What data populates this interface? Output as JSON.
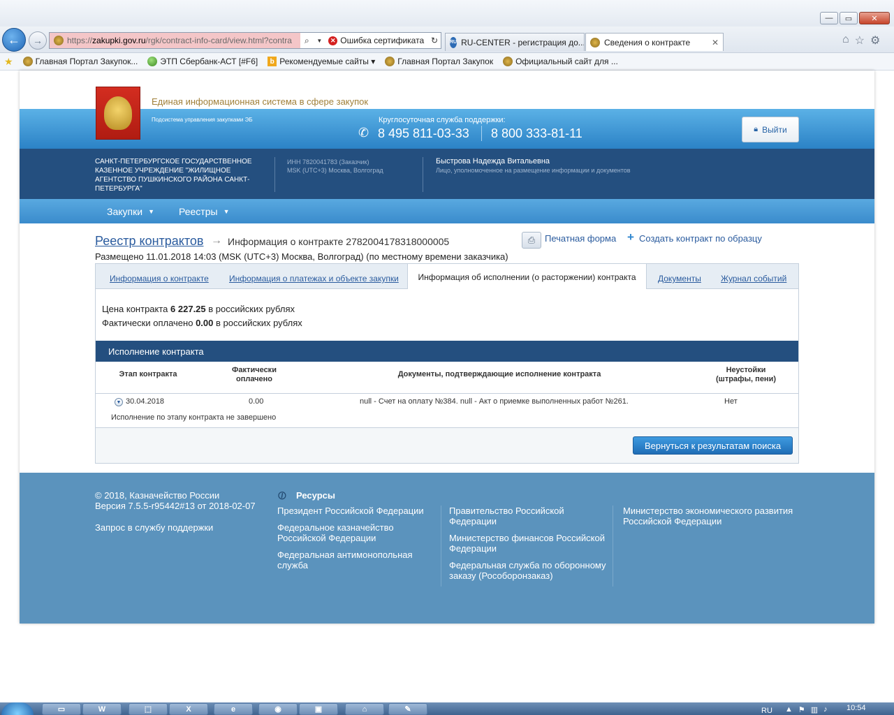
{
  "browser": {
    "url_host": "zakupki.gov.ru",
    "url_prefix": "https://",
    "url_path": "/rgk/contract-info-card/view.html?contra",
    "cert_error": "Ошибка сертификата",
    "tabs": [
      {
        "label": "RU-CENTER - регистрация до..."
      },
      {
        "label": "Сведения о контракте",
        "active": true
      }
    ],
    "favorites": [
      {
        "label": "Главная Портал Закупок..."
      },
      {
        "label": "ЭТП Сбербанк-АСТ [#F6]"
      },
      {
        "label": "Рекомендуемые сайты ▾"
      },
      {
        "label": "Главная Портал Закупок"
      },
      {
        "label": "Официальный сайт для ..."
      }
    ]
  },
  "header": {
    "system_title": "Единая информационная система в сфере закупок",
    "subsystem": "Подсистема управления закупками ЭБ",
    "support_label": "Круглосуточная служба поддержки:",
    "phone1": "8 495 811-03-33",
    "phone2": "8 800 333-81-11",
    "logout": "Выйти"
  },
  "org": {
    "name": "САНКТ-ПЕТЕРБУРГСКОЕ ГОСУДАРСТВЕННОЕ КАЗЕННОЕ УЧРЕЖДЕНИЕ \"ЖИЛИЩНОЕ АГЕНТСТВО ПУШКИНСКОГО РАЙОНА САНКТ-ПЕТЕРБУРГА\"",
    "inn": "ИНН 7820041783 (Заказчик)",
    "tz": "MSK (UTC+3) Москва, Волгоград",
    "user_name": "Быстрова Надежда Витальевна",
    "user_role": "Лицо, уполномоченное на размещение информации и документов"
  },
  "menu": {
    "purchases": "Закупки",
    "registries": "Реестры"
  },
  "content": {
    "breadcrumb": "Реестр контрактов",
    "title": "Информация о контракте 2782004178318000005",
    "print_form": "Печатная форма",
    "create_by_sample": "Создать контракт по образцу",
    "posted": "Размещено 11.01.2018 14:03 (MSK (UTC+3) Москва, Волгоград) (по местному времени заказчика)",
    "tabs": {
      "info": "Информация о контракте",
      "payments": "Информация о платежах и объекте закупки",
      "execution": "Информация об исполнении (о расторжении) контракта",
      "documents": "Документы",
      "journal": "Журнал событий"
    },
    "price_label": "Цена контракта",
    "price_value": "6 227.25",
    "price_suffix": "в российских рублях",
    "paid_label": "Фактически оплачено",
    "paid_value": "0.00",
    "paid_suffix": "в российских рублях",
    "exec_title": "Исполнение контракта",
    "table": {
      "h_stage": "Этап контракта",
      "h_paid_1": "Фактически",
      "h_paid_2": "оплачено",
      "h_docs": "Документы, подтверждающие исполнение контракта",
      "h_penalty_1": "Неустойки",
      "h_penalty_2": "(штрафы, пени)",
      "row_date": "30.04.2018",
      "row_paid": "0.00",
      "row_docs": "null - Счет на оплату №384. null - Акт о приемке выполненных работ №261.",
      "row_penalty": "Нет",
      "row_status": "Исполнение по этапу контракта не завершено"
    },
    "return_button": "Вернуться к результатам поиска"
  },
  "footer": {
    "copyright": "© 2018, Казначейство России",
    "version": "Версия 7.5.5-r95442#13 от 2018-02-07",
    "support_request": "Запрос в службу поддержки",
    "resources_title": "Ресурсы",
    "col1": [
      "Президент Российской Федерации",
      "Федеральное казначейство Российской Федерации",
      "Федеральная антимонопольная служба"
    ],
    "col2": [
      "Правительство Российской Федерации",
      "Министерство финансов Российской Федерации",
      "Федеральная служба по оборонному заказу (Рособоронзаказ)"
    ],
    "col3": [
      "Министерство экономического развития Российской Федерации"
    ]
  },
  "taskbar": {
    "lang": "RU",
    "time": "10:54"
  }
}
